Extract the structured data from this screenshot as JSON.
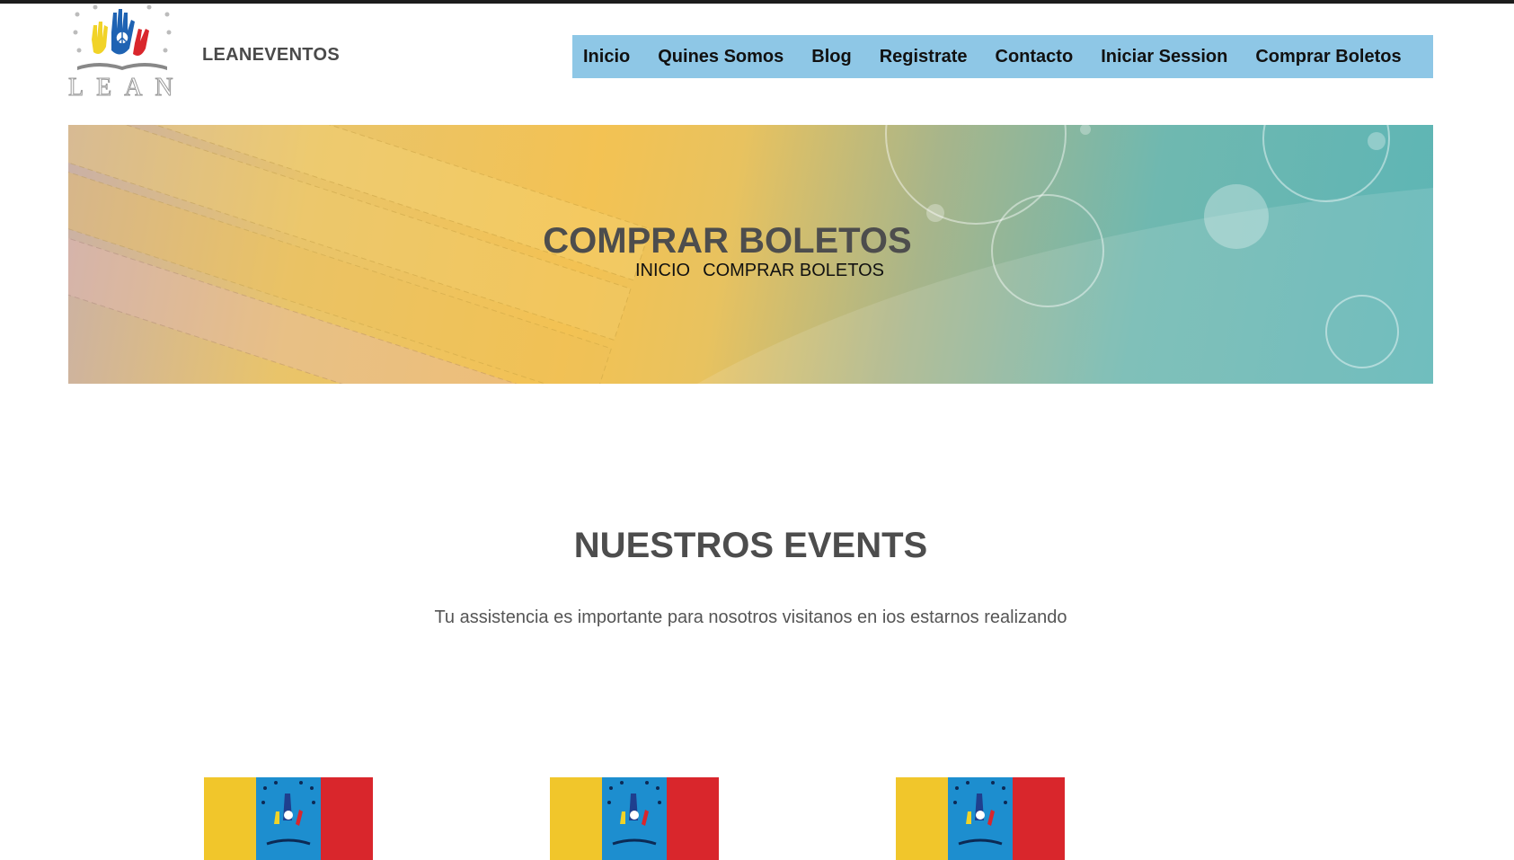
{
  "header": {
    "brand": "LEANEVENTOS",
    "logo_text": "LEAN"
  },
  "nav": {
    "items": [
      {
        "label": "Inicio"
      },
      {
        "label": "Quines Somos"
      },
      {
        "label": "Blog"
      },
      {
        "label": "Registrate"
      },
      {
        "label": "Contacto"
      },
      {
        "label": "Iniciar Session"
      },
      {
        "label": "Comprar Boletos"
      }
    ]
  },
  "banner": {
    "title": "COMPRAR BOLETOS",
    "breadcrumb": {
      "home": "INICIO",
      "current": "COMPRAR BOLETOS"
    }
  },
  "events": {
    "title": "NUESTROS EVENTS",
    "subtitle": "Tu assistencia es importante para nosotros visitanos en ios estarnos realizando"
  },
  "colors": {
    "nav_bg": "#8ec7e6",
    "heading": "#4d4d4d",
    "flag_yellow": "#f1c62b",
    "flag_blue": "#1d8ecf",
    "flag_red": "#d9262c"
  }
}
